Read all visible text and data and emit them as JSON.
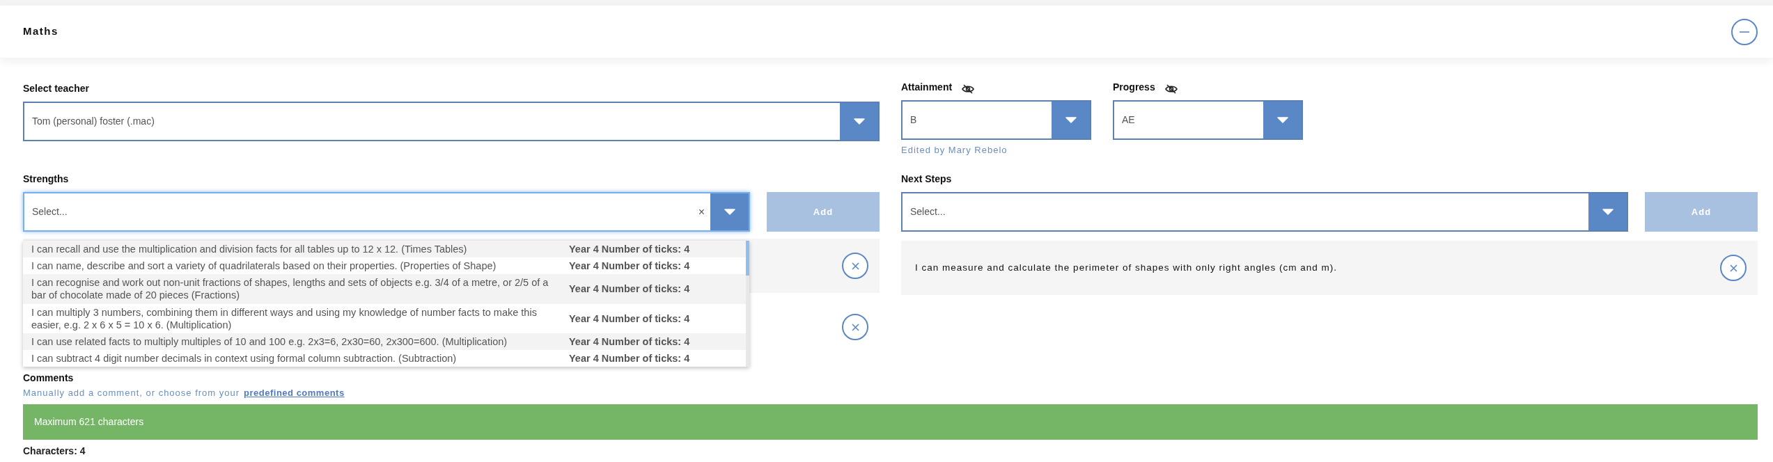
{
  "header": {
    "title": "Maths"
  },
  "teacher": {
    "label": "Select teacher",
    "value": "Tom (personal) foster (.mac)"
  },
  "attainment": {
    "label": "Attainment",
    "value": "B",
    "hidden": true,
    "edited_by": "Edited by Mary Rebelo"
  },
  "progress": {
    "label": "Progress",
    "value": "AE",
    "hidden": true
  },
  "strengths": {
    "label": "Strengths",
    "placeholder": "Select...",
    "focused": true,
    "clear": "×",
    "add_button": "Add",
    "add_disabled": true,
    "items": [
      {
        "kind": "strength"
      },
      {
        "kind": "strength"
      }
    ],
    "dropdown": {
      "open": true,
      "options": [
        {
          "text": "I can recall and use the multiplication and division facts for all tables up to 12 x 12. (Times Tables)",
          "meta": "Year 4 Number of ticks: 4"
        },
        {
          "text": "I can name, describe and sort a variety of quadrilaterals based on their properties. (Properties of Shape)",
          "meta": "Year 4 Number of ticks: 4"
        },
        {
          "text": "I can recognise and work out non-unit fractions of shapes, lengths and sets of objects e.g. 3/4 of a metre, or 2/5 of a bar of chocolate made of 20 pieces (Fractions)",
          "meta": "Year 4 Number of ticks: 4"
        },
        {
          "text": "I can multiply 3 numbers, combining them in different ways and using my knowledge of number facts to make this easier, e.g. 2 x 6 x 5 = 10 x 6. (Multiplication)",
          "meta": "Year 4 Number of ticks: 4"
        },
        {
          "text": "I can use related facts to multiply multiples of 10 and 100 e.g. 2x3=6, 2x30=60, 2x300=600. (Multiplication)",
          "meta": "Year 4 Number of ticks: 4"
        },
        {
          "text": "I can subtract 4 digit number decimals in context using formal column subtraction. (Subtraction)",
          "meta": "Year 4 Number of ticks: 4"
        }
      ]
    }
  },
  "next_steps": {
    "label": "Next Steps",
    "placeholder": "Select...",
    "add_button": "Add",
    "add_disabled": true,
    "items": [
      {
        "text": "I can measure and calculate the perimeter of shapes with only right angles (cm and m)."
      }
    ]
  },
  "comments": {
    "label": "Comments",
    "hint": "Manually add a comment, or choose from your",
    "link": "predefined comments",
    "notice": "Maximum 621 characters",
    "counter": "Characters: 4"
  }
}
